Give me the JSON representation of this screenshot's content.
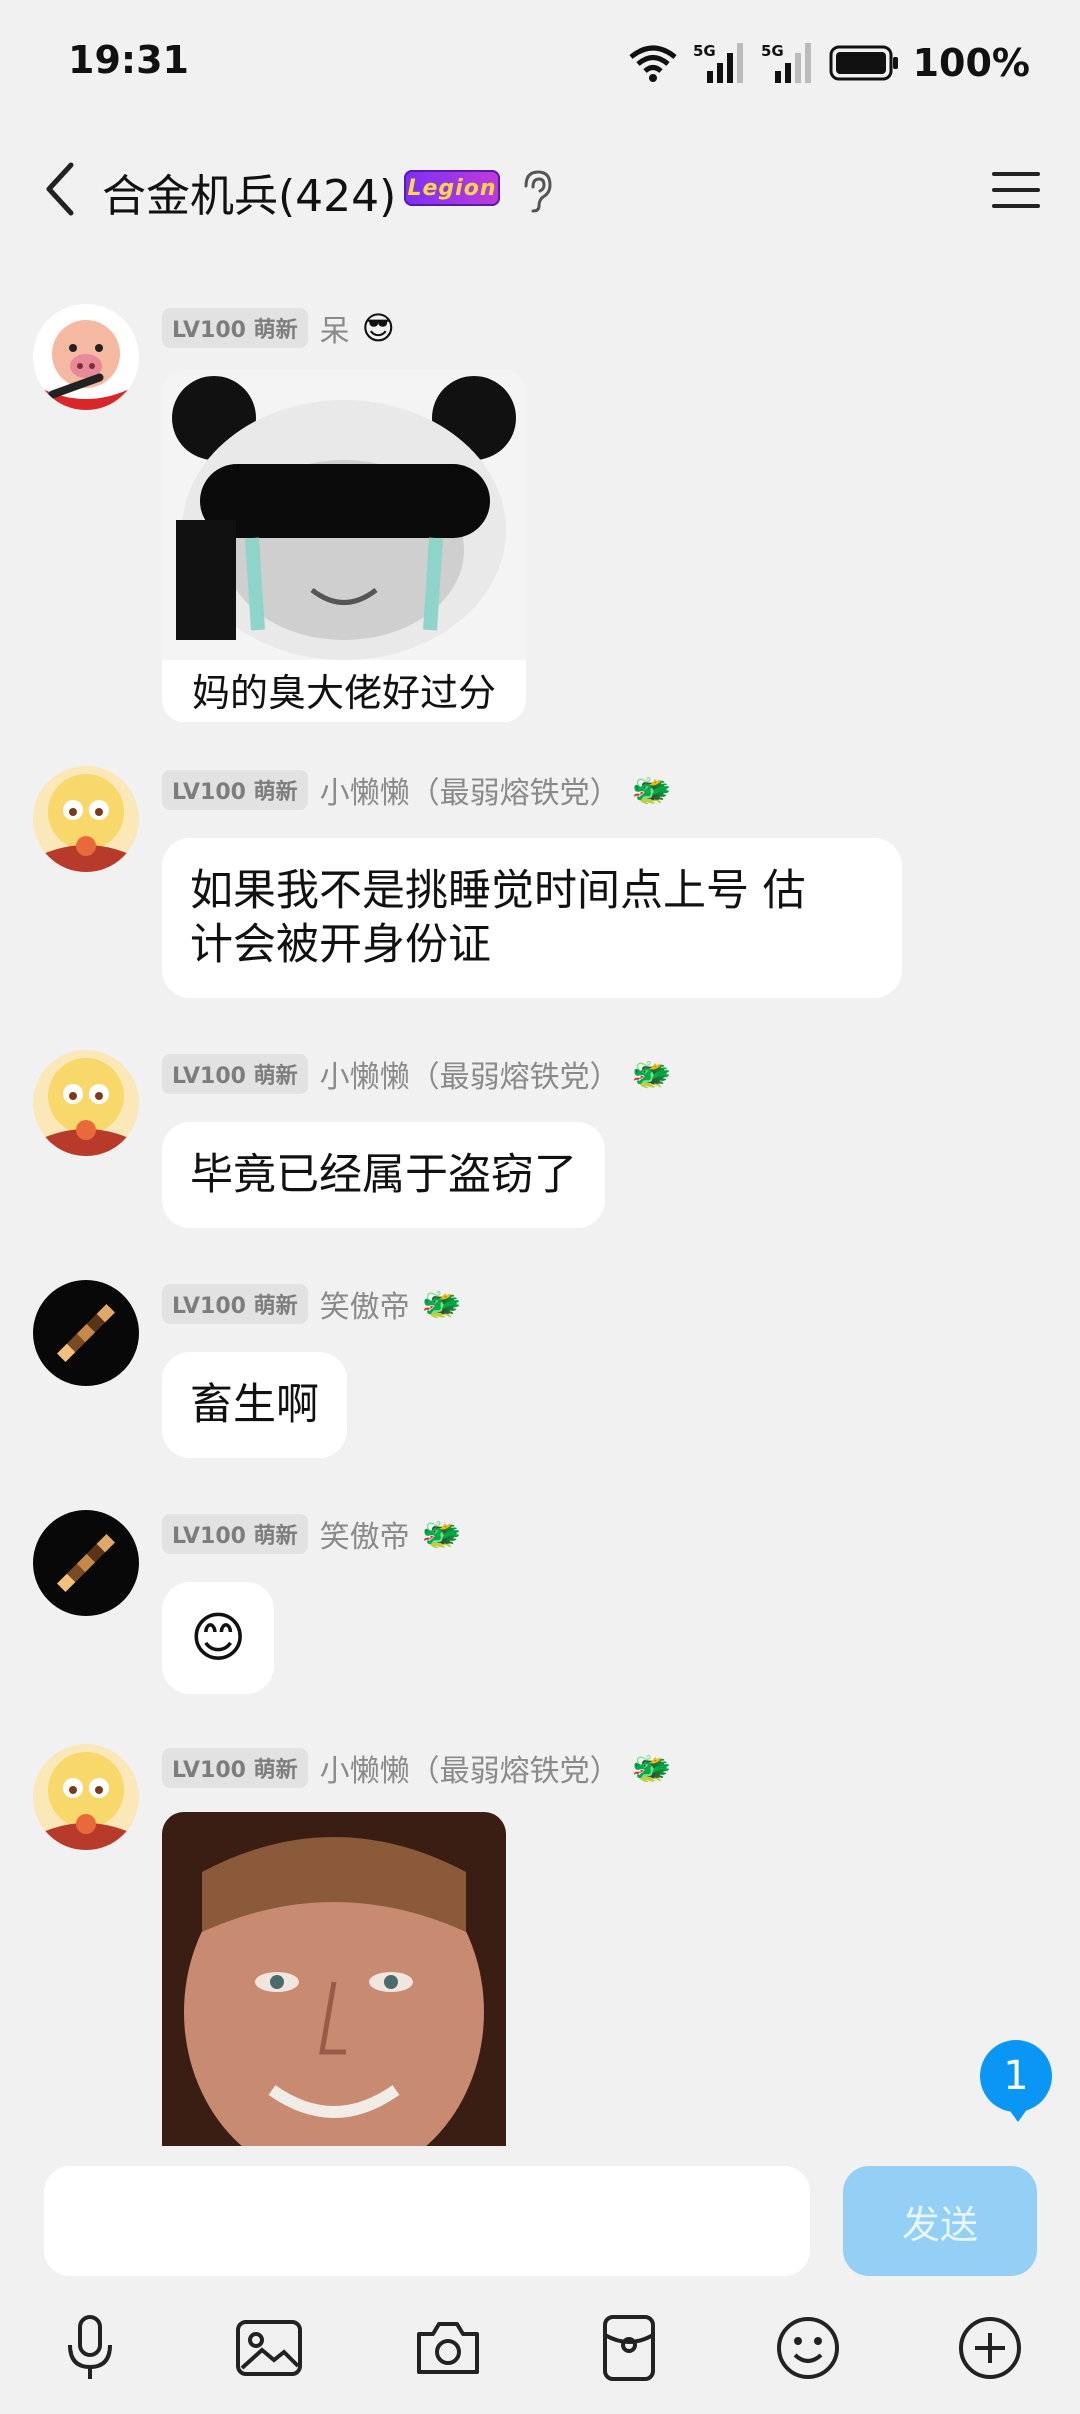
{
  "status_bar": {
    "time": "19:31",
    "battery": "100%"
  },
  "header": {
    "title": "合金机兵(424)",
    "badge": "Legion"
  },
  "messages": [
    {
      "level": "LV100 萌新",
      "sender": "呆",
      "type": "image",
      "image_caption": "妈的臭大佬好过分"
    },
    {
      "level": "LV100 萌新",
      "sender": "小懒懒（最弱熔铁党）",
      "type": "text",
      "text_lines": [
        "如果我不是挑睡觉时间点上号 估",
        "计会被开身份证"
      ]
    },
    {
      "level": "LV100 萌新",
      "sender": "小懒懒（最弱熔铁党）",
      "type": "text",
      "text": "毕竟已经属于盗窃了"
    },
    {
      "level": "LV100 萌新",
      "sender": "笑傲帝",
      "type": "text",
      "text": "畜生啊"
    },
    {
      "level": "LV100 萌新",
      "sender": "笑傲帝",
      "type": "emoji",
      "emoji": "😊"
    },
    {
      "level": "LV100 萌新",
      "sender": "小懒懒（最弱熔铁党）",
      "type": "image"
    }
  ],
  "unread_count": "1",
  "input": {
    "placeholder": "",
    "value": "",
    "send_label": "发送"
  },
  "icons": {
    "back": "back-arrow-icon",
    "ear": "ear-icon",
    "menu": "menu-icon",
    "toolbar": [
      "microphone-icon",
      "image-icon",
      "camera-icon",
      "red-packet-icon",
      "emoji-icon",
      "plus-icon"
    ]
  },
  "colors": {
    "background": "#f1f1f1",
    "bubble": "#ffffff",
    "send_button": "#94d0f5",
    "unread_badge": "#0a96f5"
  }
}
